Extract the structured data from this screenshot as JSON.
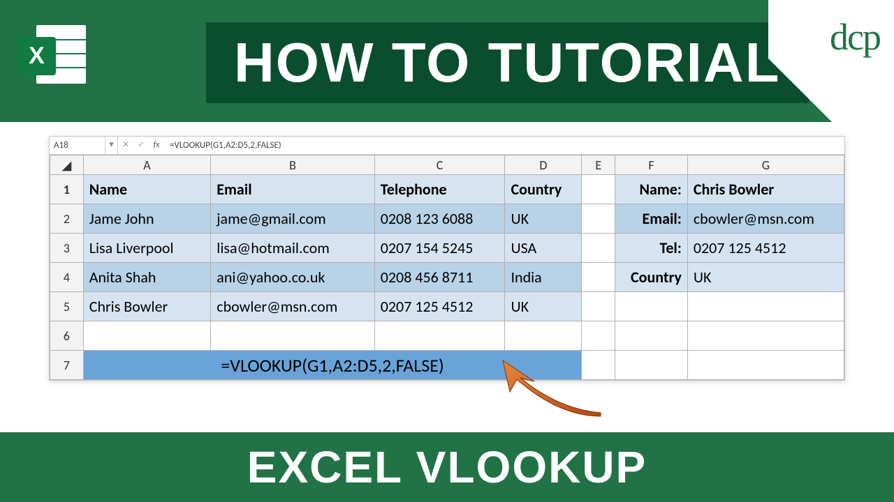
{
  "branding": {
    "title": "HOW TO TUTORIAL",
    "footer": "EXCEL VLOOKUP",
    "logo_text": "dcp",
    "excel_x": "X"
  },
  "formula_bar": {
    "cell_ref": "A18",
    "formula": "=VLOOKUP(G1,A2:D5,2,FALSE)"
  },
  "columns": [
    "A",
    "B",
    "C",
    "D",
    "E",
    "F",
    "G"
  ],
  "rownums": [
    "1",
    "2",
    "3",
    "4",
    "5",
    "6",
    "7"
  ],
  "headers": {
    "name": "Name",
    "email": "Email",
    "telephone": "Telephone",
    "country": "Country"
  },
  "data": [
    {
      "name": "Jame John",
      "email": "jame@gmail.com",
      "tel": "0208 123 6088",
      "country": "UK"
    },
    {
      "name": "Lisa Liverpool",
      "email": "lisa@hotmail.com",
      "tel": "0207 154 5245",
      "country": "USA"
    },
    {
      "name": "Anita Shah",
      "email": "ani@yahoo.co.uk",
      "tel": "0208 456 8711",
      "country": "India"
    },
    {
      "name": "Chris Bowler",
      "email": "cbowler@msn.com",
      "tel": "0207 125 4512",
      "country": "UK"
    }
  ],
  "lookup": {
    "labels": {
      "name": "Name:",
      "email": "Email:",
      "tel": "Tel:",
      "country": "Country"
    },
    "values": {
      "name": "Chris Bowler",
      "email": "cbowler@msn.com",
      "tel": "0207 125 4512",
      "country": "UK"
    }
  },
  "formula_display": "=VLOOKUP(G1,A2:D5,2,FALSE)"
}
